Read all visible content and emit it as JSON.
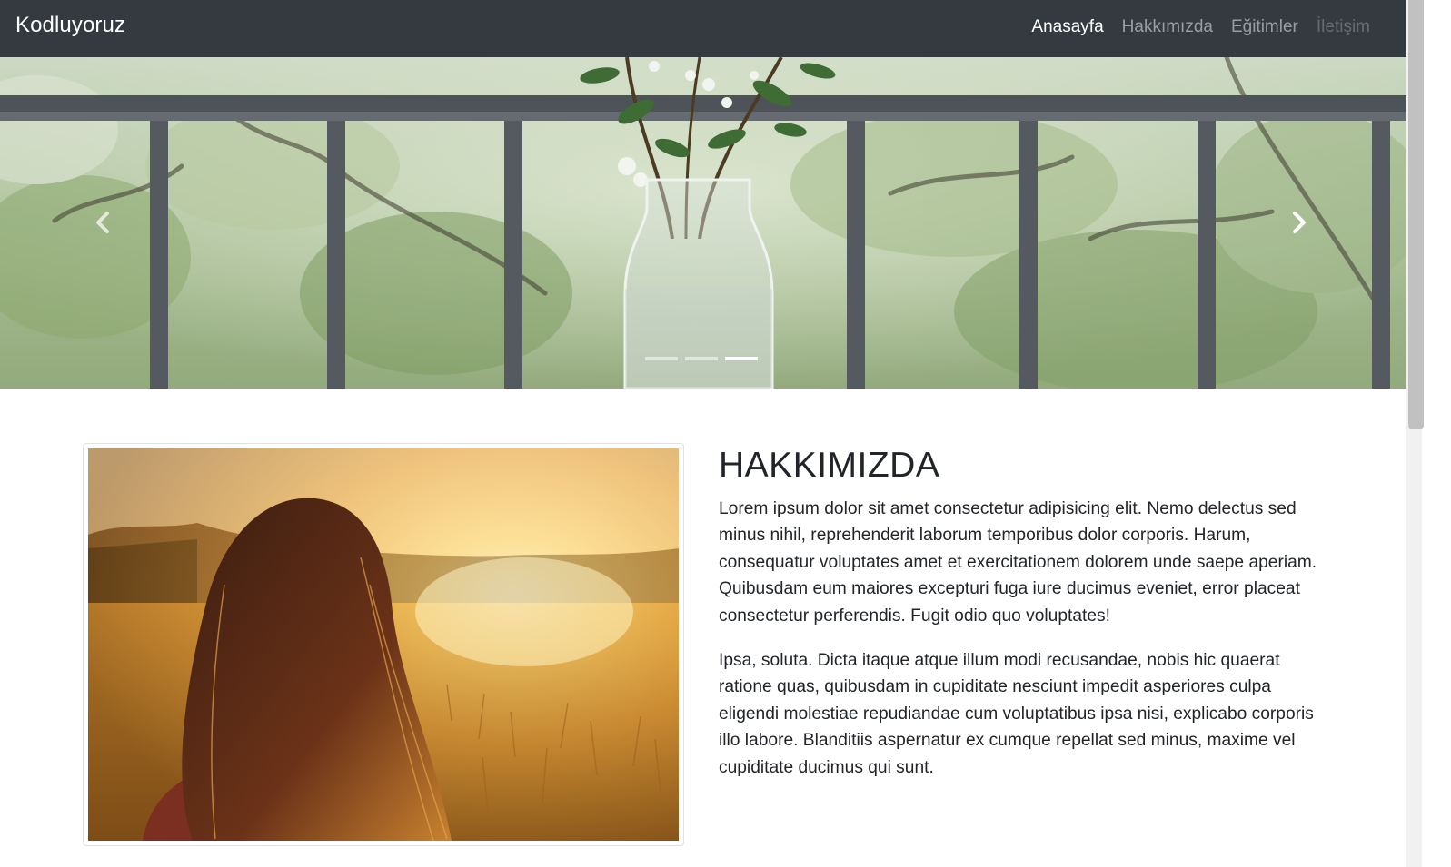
{
  "navbar": {
    "brand": "Kodluyoruz",
    "links": [
      {
        "label": "Anasayfa",
        "state": "active"
      },
      {
        "label": "Hakkımızda",
        "state": "normal"
      },
      {
        "label": "Eğitimler",
        "state": "normal"
      },
      {
        "label": "İletişim",
        "state": "disabled"
      }
    ]
  },
  "carousel": {
    "image": "vase-on-balcony-photo",
    "prev_icon": "chevron-left-icon",
    "next_icon": "chevron-right-icon",
    "slide_count": 3,
    "active_slide": 3
  },
  "about": {
    "image": "girl-in-sunset-field-photo",
    "title": "HAKKIMIZDA",
    "paragraphs": [
      "Lorem ipsum dolor sit amet consectetur adipisicing elit. Nemo delectus sed minus nihil, reprehenderit laborum temporibus dolor corporis. Harum, consequatur voluptates amet et exercitationem dolorem unde saepe aperiam. Quibusdam eum maiores excepturi fuga iure ducimus eveniet, error placeat consectetur perferendis. Fugit odio quo voluptates!",
      "Ipsa, soluta. Dicta itaque atque illum modi recusandae, nobis hic quaerat ratione quas, quibusdam in cupiditate nesciunt impedit asperiores culpa eligendi molestiae repudiandae cum voluptatibus ipsa nisi, explicabo corporis illo labore. Blanditiis aspernatur ex cumque repellat sed minus, maxime vel cupiditate ducimus qui sunt."
    ]
  },
  "colors": {
    "navbar_bg": "#343a40",
    "text": "#212529",
    "border": "#dee2e6"
  }
}
